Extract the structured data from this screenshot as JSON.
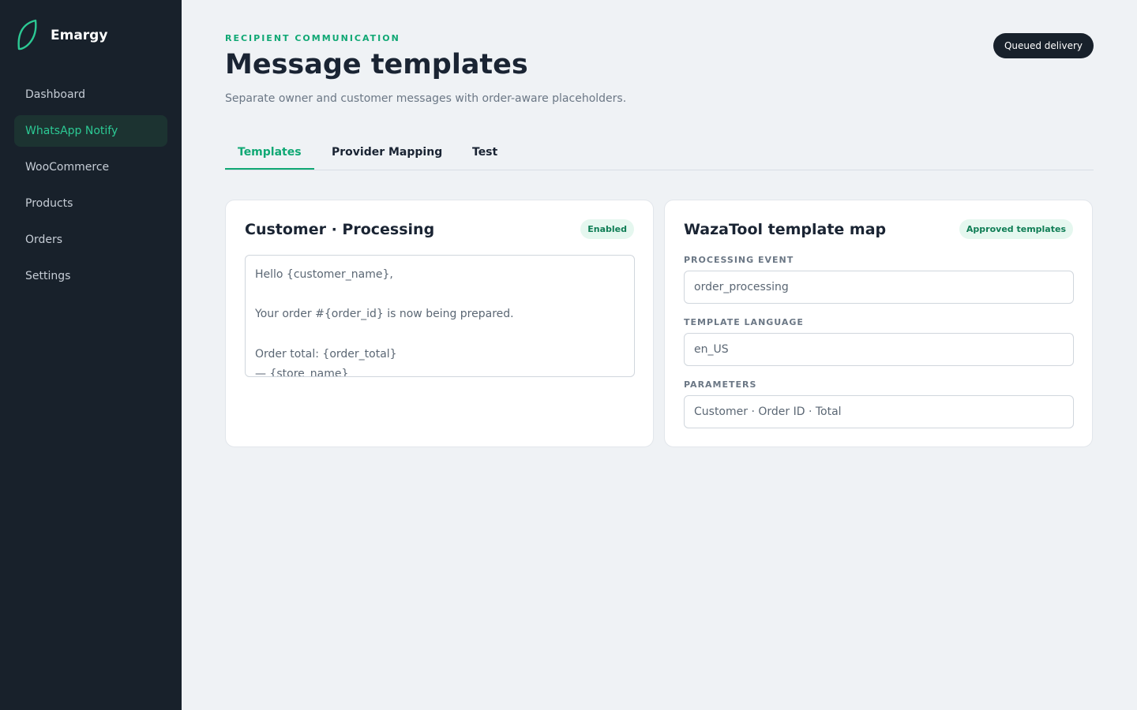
{
  "brand": {
    "name": "Emargy",
    "accent": "#2cc994"
  },
  "nav": [
    {
      "label": "Dashboard"
    },
    {
      "label": "WhatsApp Notify"
    },
    {
      "label": "WooCommerce"
    },
    {
      "label": "Products"
    },
    {
      "label": "Orders"
    },
    {
      "label": "Settings"
    }
  ],
  "header": {
    "eyebrow": "RECIPIENT COMMUNICATION",
    "title": "Message templates",
    "subtitle": "Separate owner and customer messages with order-aware placeholders.",
    "pill": "Queued delivery"
  },
  "tabs": [
    {
      "label": "Templates"
    },
    {
      "label": "Provider Mapping"
    },
    {
      "label": "Test"
    }
  ],
  "template_card": {
    "title": "Customer · Processing",
    "badge": "Enabled",
    "body": "Hello {customer_name},\n\nYour order #{order_id} is now being prepared.\n\nOrder total: {order_total}\n— {store_name}"
  },
  "map_card": {
    "title": "WazaTool template map",
    "badge": "Approved templates",
    "fields": [
      {
        "label": "PROCESSING EVENT",
        "value": "order_processing"
      },
      {
        "label": "TEMPLATE LANGUAGE",
        "value": "en_US"
      },
      {
        "label": "PARAMETERS",
        "value": "Customer · Order ID · Total"
      }
    ]
  }
}
